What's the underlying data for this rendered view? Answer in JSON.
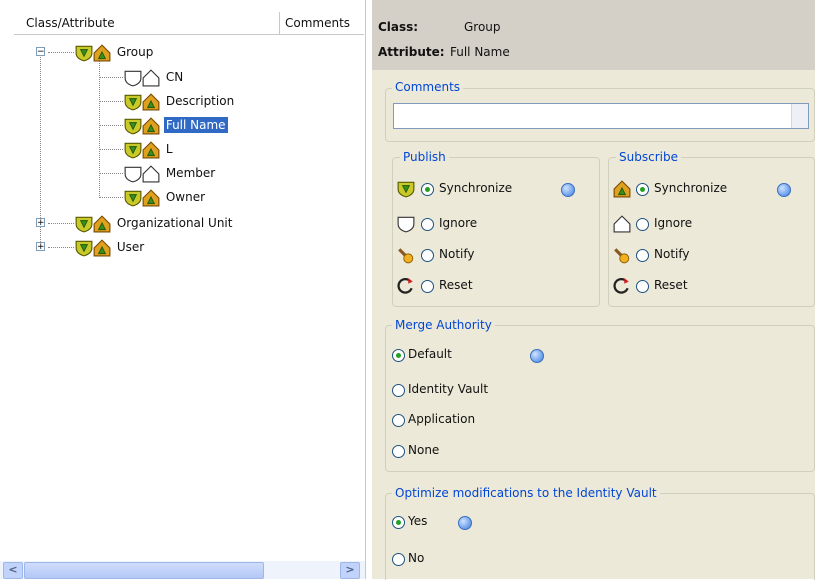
{
  "left": {
    "header": {
      "col1": "Class/Attribute",
      "col2": "Comments"
    },
    "tree": {
      "group": {
        "label": "Group",
        "expander": "⊟"
      },
      "attributes": [
        {
          "label": "CN",
          "icons": "ignore"
        },
        {
          "label": "Description",
          "icons": "sync"
        },
        {
          "label": "Full Name",
          "icons": "sync",
          "selected": true
        },
        {
          "label": "L",
          "icons": "sync"
        },
        {
          "label": "Member",
          "icons": "ignore"
        },
        {
          "label": "Owner",
          "icons": "sync"
        }
      ],
      "others": [
        {
          "label": "Organizational Unit",
          "expander": "+"
        },
        {
          "label": "User",
          "expander": "+"
        }
      ]
    },
    "scroll": {
      "left_arrow": "<",
      "right_arrow": ">"
    }
  },
  "right": {
    "class_label": "Class:",
    "class_value": "Group",
    "attribute_label": "Attribute:",
    "attribute_value": "Full Name",
    "comments": {
      "title": "Comments",
      "value": ""
    },
    "publish": {
      "title": "Publish",
      "options": [
        "Synchronize",
        "Ignore",
        "Notify",
        "Reset"
      ],
      "selected": "Synchronize"
    },
    "subscribe": {
      "title": "Subscribe",
      "options": [
        "Synchronize",
        "Ignore",
        "Notify",
        "Reset"
      ],
      "selected": "Synchronize"
    },
    "merge": {
      "title": "Merge Authority",
      "options": [
        "Default",
        "Identity Vault",
        "Application",
        "None"
      ],
      "selected": "Default"
    },
    "optimize": {
      "title": "Optimize modifications to the Identity Vault",
      "options": [
        "Yes",
        "No"
      ],
      "selected": "Yes"
    }
  },
  "colors": {
    "accent": "#0046d5",
    "selection": "#316ac5",
    "panel": "#ece9d8",
    "radio_dot": "#21a121"
  }
}
